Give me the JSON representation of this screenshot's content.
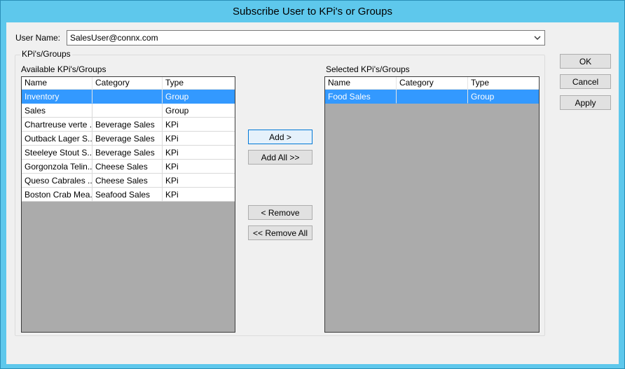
{
  "window": {
    "title": "Subscribe User to KPi's or Groups"
  },
  "user": {
    "label": "User Name:",
    "value": "SalesUser@connx.com"
  },
  "group": {
    "title": "KPi's/Groups"
  },
  "available": {
    "label": "Available KPi's/Groups",
    "columns": [
      "Name",
      "Category",
      "Type"
    ],
    "rows": [
      {
        "name": "Inventory",
        "category": "",
        "type": "Group",
        "selected": true
      },
      {
        "name": "Sales",
        "category": "",
        "type": "Group",
        "selected": false
      },
      {
        "name": "Chartreuse verte ...",
        "category": "Beverage Sales",
        "type": "KPi",
        "selected": false
      },
      {
        "name": "Outback Lager S...",
        "category": "Beverage Sales",
        "type": "KPi",
        "selected": false
      },
      {
        "name": "Steeleye Stout S...",
        "category": "Beverage Sales",
        "type": "KPi",
        "selected": false
      },
      {
        "name": "Gorgonzola Telin...",
        "category": "Cheese Sales",
        "type": "KPi",
        "selected": false
      },
      {
        "name": "Queso Cabrales ...",
        "category": "Cheese Sales",
        "type": "KPi",
        "selected": false
      },
      {
        "name": "Boston Crab Mea...",
        "category": "Seafood Sales",
        "type": "KPi",
        "selected": false
      }
    ]
  },
  "selected": {
    "label": "Selected KPi's/Groups",
    "columns": [
      "Name",
      "Category",
      "Type"
    ],
    "rows": [
      {
        "name": "Food Sales",
        "category": "",
        "type": "Group",
        "selected": true
      }
    ]
  },
  "buttons": {
    "add": "Add >",
    "add_all": "Add All >>",
    "remove": "< Remove",
    "remove_all": "<< Remove All",
    "ok": "OK",
    "cancel": "Cancel",
    "apply": "Apply"
  },
  "icons": {
    "dropdown": "chevron-down-icon"
  }
}
